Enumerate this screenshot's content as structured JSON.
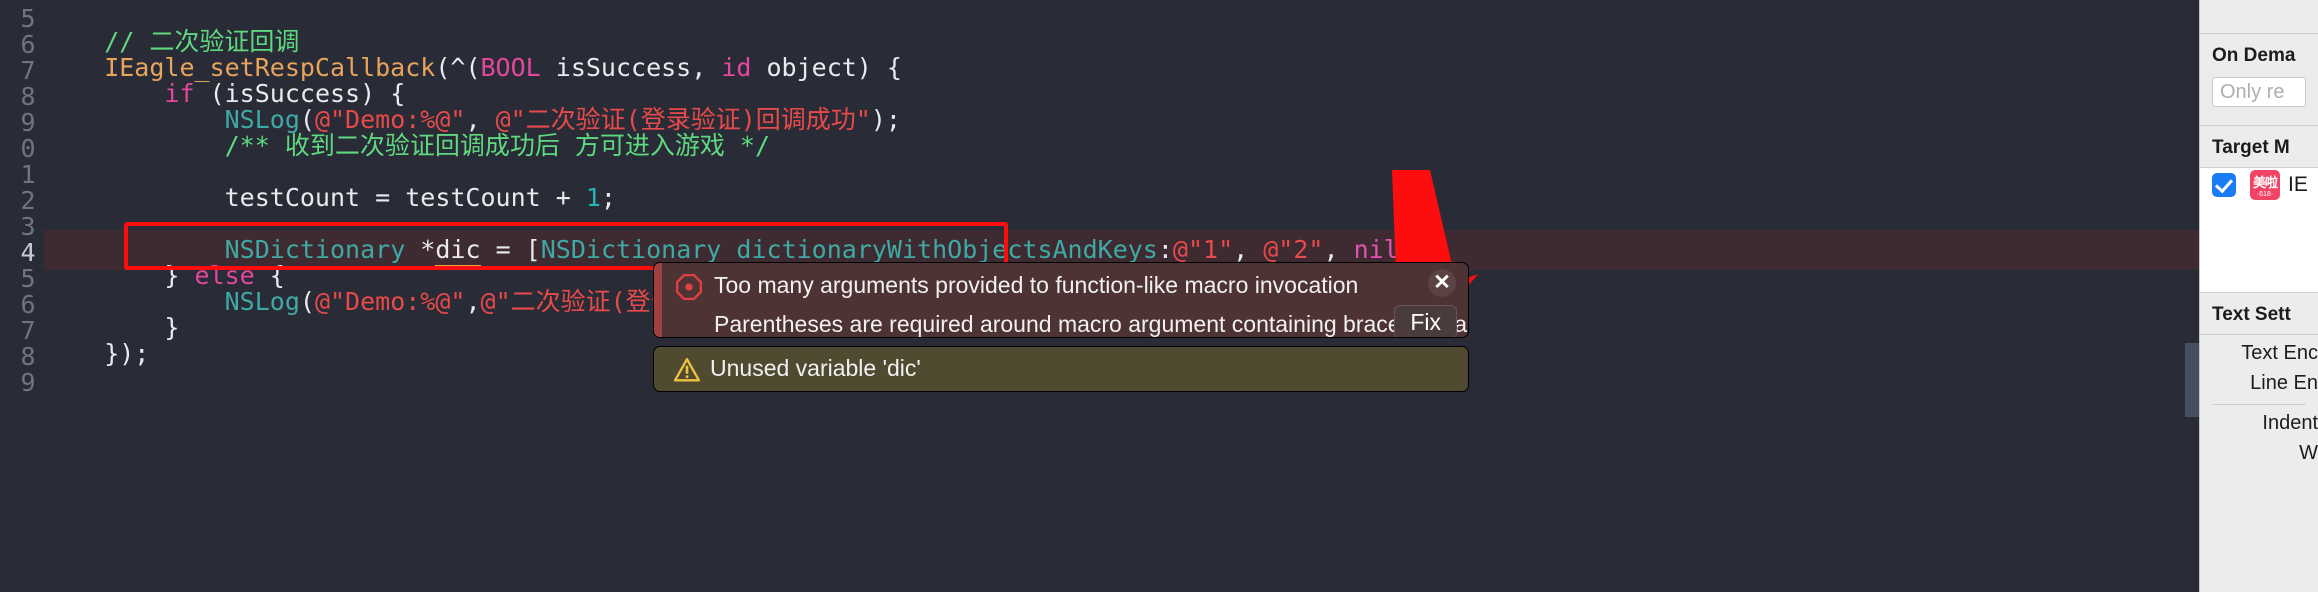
{
  "editor": {
    "language": "objective-c",
    "theme_bg": "#292c36",
    "line_numbers": [
      "5",
      "6",
      "7",
      "8",
      "9",
      "0",
      "1",
      "2",
      "3",
      "4",
      "5",
      "6",
      "7",
      "8",
      "9"
    ],
    "current_line_number": "4",
    "lines": [
      {
        "n": "5",
        "text": ""
      },
      {
        "n": "6",
        "text": "    // 二次验证回调"
      },
      {
        "n": "7",
        "text": "    IEagle_setRespCallback(^(BOOL isSuccess, id object) {"
      },
      {
        "n": "8",
        "text": "        if (isSuccess) {"
      },
      {
        "n": "9",
        "text": "            NSLog(@\"Demo:%@\", @\"二次验证(登录验证)回调成功\");"
      },
      {
        "n": "0",
        "text": "            /** 收到二次验证回调成功后 方可进入游戏 */"
      },
      {
        "n": "1",
        "text": ""
      },
      {
        "n": "2",
        "text": "            testCount = testCount + 1;"
      },
      {
        "n": "3",
        "text": ""
      },
      {
        "n": "4",
        "text": "            NSDictionary *dic = [NSDictionary dictionaryWithObjectsAndKeys:@\"1\", @\"2\", nil];"
      },
      {
        "n": "5",
        "text": "        } else {"
      },
      {
        "n": "6",
        "text": "            NSLog(@\"Demo:%@\",@\"二次验证(登录验证)回调失败\");"
      },
      {
        "n": "7",
        "text": "        }"
      },
      {
        "n": "8",
        "text": "    });"
      },
      {
        "n": "9",
        "text": ""
      }
    ],
    "misspelled_word": "dic"
  },
  "issues": {
    "error": {
      "icon": "error-octagon-icon",
      "message_line1": "Too many arguments provided to function-like macro invocation",
      "message_line2": "Parentheses are required around macro argument containing braced initializer list",
      "fix_label": "Fix",
      "close_label": "✕",
      "accent": "#a14040",
      "background": "#4e3334"
    },
    "warning": {
      "icon": "warning-triangle-icon",
      "message": "Unused variable 'dic'",
      "accent": "#b8922a",
      "background": "#4f4a30"
    }
  },
  "annotations": {
    "box_color": "#fd0d0d",
    "arrow_color": "#fd0d0d"
  },
  "inspector": {
    "on_demand": {
      "title": "On Dema",
      "placeholder": "Only re"
    },
    "target_membership": {
      "title": "Target M",
      "items": [
        {
          "checked": true,
          "icon_line1": "美啦",
          "icon_line2": "·618·",
          "icon_color": "#ef4464",
          "label": "IE"
        }
      ]
    },
    "text_settings": {
      "title": "Text Sett",
      "rows": [
        "Text Enc",
        "Line En",
        "Indent",
        "W"
      ]
    }
  }
}
